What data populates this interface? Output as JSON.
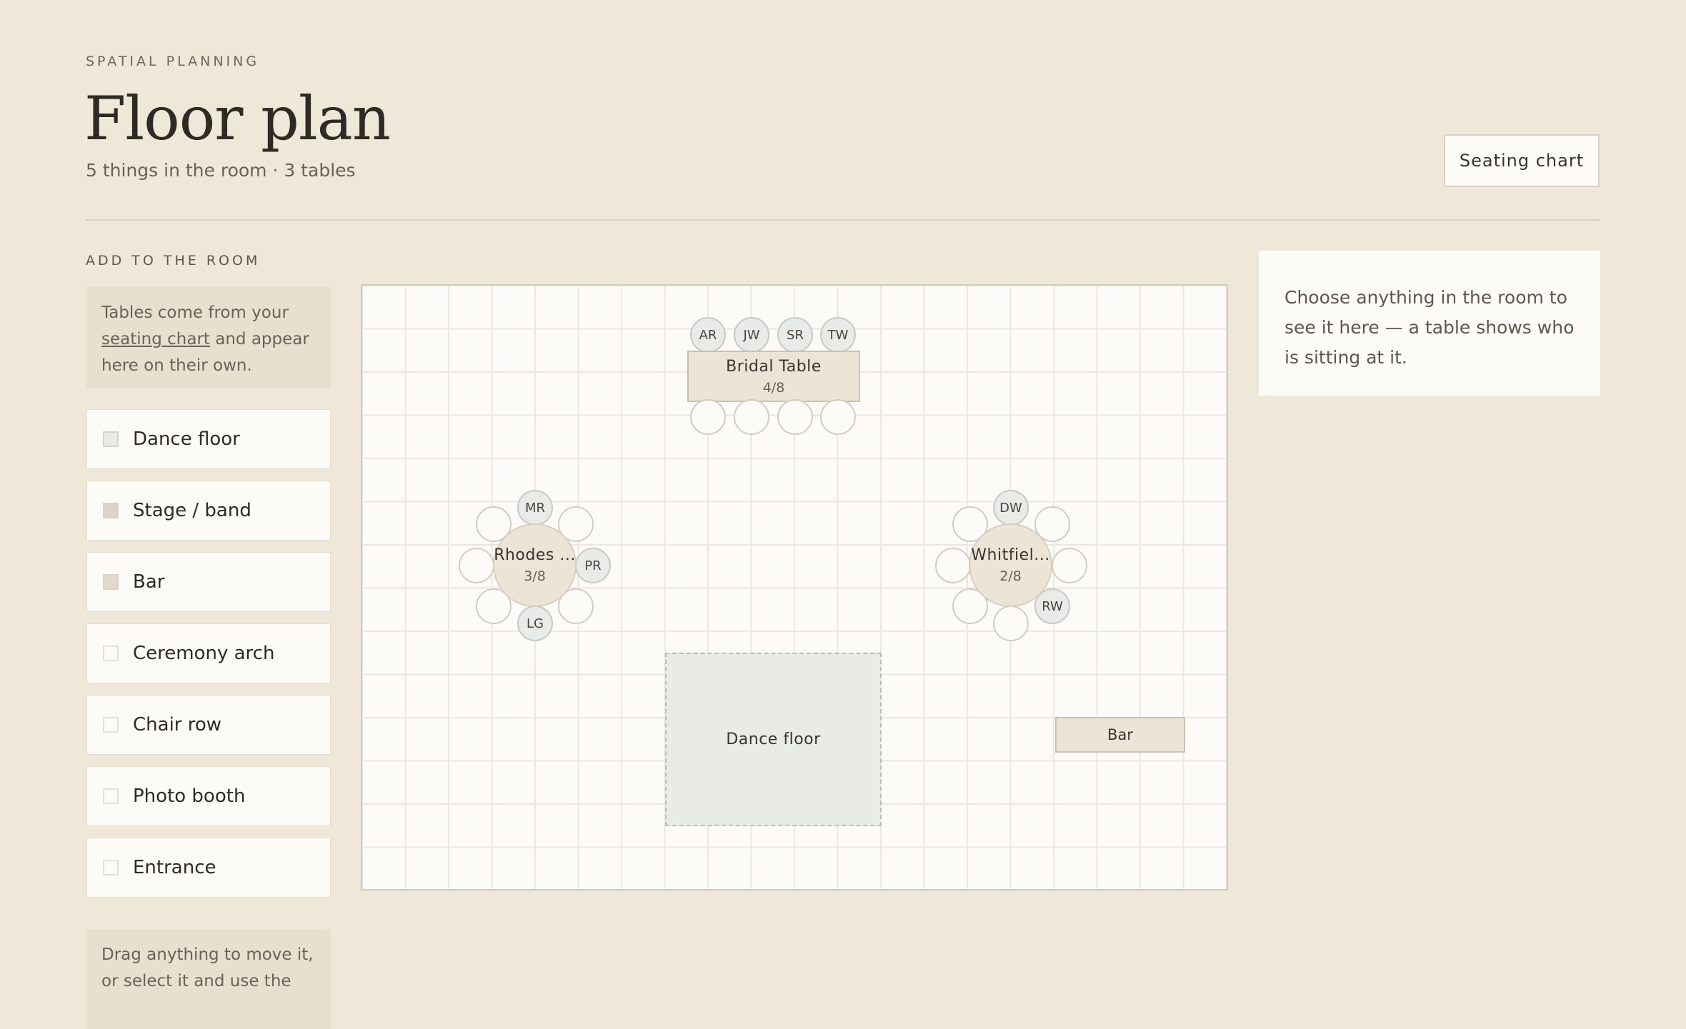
{
  "header": {
    "eyebrow": "SPATIAL PLANNING",
    "title": "Floor plan",
    "subtitle": "5 things in the room · 3 tables",
    "seating_chart_button": "Seating chart"
  },
  "sidebar": {
    "section_label": "ADD TO THE ROOM",
    "note_before_link": "Tables come from your ",
    "note_link": "seating chart",
    "note_after_link": " and appear here on their own.",
    "items": [
      {
        "label": "Dance floor",
        "swatch": "#e8ebe6"
      },
      {
        "label": "Stage / band",
        "swatch": "#d9d3c8"
      },
      {
        "label": "Bar",
        "swatch": "#e2d9ca"
      },
      {
        "label": "Ceremony arch",
        "swatch": "#fcfbf8"
      },
      {
        "label": "Chair row",
        "swatch": "#fcfbf8"
      },
      {
        "label": "Photo booth",
        "swatch": "#fcfbf8"
      },
      {
        "label": "Entrance",
        "swatch": "#fcfbf8"
      }
    ],
    "bottom_note": "Drag anything to move it, or select it and use the"
  },
  "floor": {
    "bridal": {
      "name": "Bridal Table",
      "count": "4/8",
      "top_guests": [
        "AR",
        "JW",
        "SR",
        "TW"
      ]
    },
    "rhodes": {
      "name": "Rhodes ...",
      "count": "3/8",
      "guest_top": "MR",
      "guest_right": "PR",
      "guest_bottom": "LG"
    },
    "whitfield": {
      "name": "Whitfiel...",
      "count": "2/8",
      "guest_top": "DW",
      "guest_bottom_right": "RW"
    },
    "dance_floor": "Dance floor",
    "bar": "Bar"
  },
  "info_panel": {
    "text": "Choose anything in the room to see it here — a table shows who is sitting at it."
  }
}
